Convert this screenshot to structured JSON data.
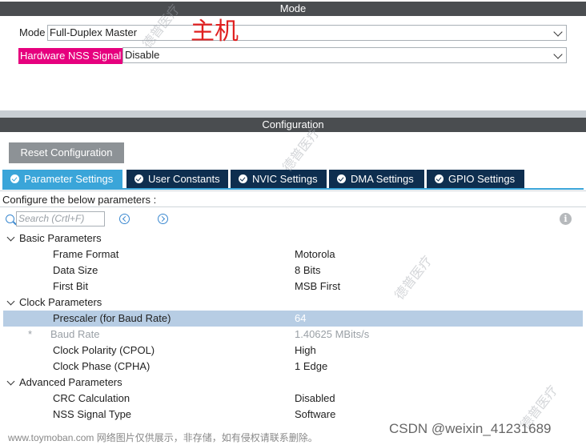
{
  "mode": {
    "header": "Mode",
    "mode_label": "Mode",
    "mode_value": "Full-Duplex Master",
    "nss_label": "Hardware NSS Signal",
    "nss_value": "Disable",
    "annotation": "主机"
  },
  "configuration": {
    "header": "Configuration",
    "reset_label": "Reset Configuration",
    "tabs": [
      {
        "label": "Parameter Settings",
        "active": true
      },
      {
        "label": "User Constants",
        "active": false
      },
      {
        "label": "NVIC Settings",
        "active": false
      },
      {
        "label": "DMA Settings",
        "active": false
      },
      {
        "label": "GPIO Settings",
        "active": false
      }
    ],
    "configure_text": "Configure the below parameters :",
    "search_placeholder": "Search (Crtl+F)"
  },
  "groups": {
    "basic": {
      "label": "Basic Parameters",
      "params": [
        {
          "name": "Frame Format",
          "value": "Motorola"
        },
        {
          "name": "Data Size",
          "value": "8 Bits"
        },
        {
          "name": "First Bit",
          "value": "MSB First"
        }
      ]
    },
    "clock": {
      "label": "Clock Parameters",
      "params": [
        {
          "name": "Prescaler (for Baud Rate)",
          "value": "64"
        },
        {
          "name": "Baud Rate",
          "value": "1.40625 MBits/s",
          "star": "*"
        },
        {
          "name": "Clock Polarity (CPOL)",
          "value": "High"
        },
        {
          "name": "Clock Phase (CPHA)",
          "value": "1 Edge"
        }
      ]
    },
    "advanced": {
      "label": "Advanced Parameters",
      "params": [
        {
          "name": "CRC Calculation",
          "value": "Disabled"
        },
        {
          "name": "NSS Signal Type",
          "value": "Software"
        }
      ]
    }
  },
  "footer": {
    "note": "www.toymoban.com 网络图片仅供展示，非存储，如有侵权请联系删除。",
    "brand": "CSDN @weixin_41231689",
    "watermark": "德普医疗"
  },
  "colors": {
    "header_bg": "#4a4d50",
    "tab_active": "#3aa5d9",
    "tab_inactive": "#0e2e4f",
    "nss_highlight": "#e6007e",
    "selected_row": "#b7cde4"
  }
}
